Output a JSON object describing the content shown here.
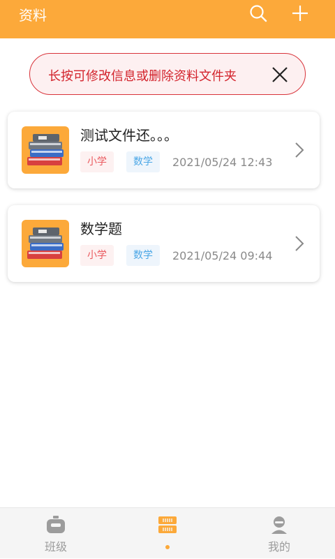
{
  "header": {
    "title": "资料",
    "search_icon": "search-icon",
    "add_icon": "plus-icon"
  },
  "tip": {
    "text": "长按可修改信息或删除资料文件夹",
    "close_icon": "close-icon"
  },
  "folders": [
    {
      "name": "测试文件还。。。",
      "level": "小学",
      "subject": "数学",
      "date": "2021/05/24 12:43"
    },
    {
      "name": "数学题",
      "level": "小学",
      "subject": "数学",
      "date": "2021/05/24 09:44"
    }
  ],
  "bottom_nav": {
    "tabs": [
      {
        "label": "班级",
        "icon": "class-icon"
      },
      {
        "label": "",
        "icon": "materials-icon",
        "active": true
      },
      {
        "label": "我的",
        "icon": "profile-icon"
      }
    ]
  },
  "colors": {
    "accent": "#fca93a",
    "tip_red": "#d3232c",
    "tag_red": "#ea5a5f",
    "tag_blue": "#4ba7e6"
  }
}
